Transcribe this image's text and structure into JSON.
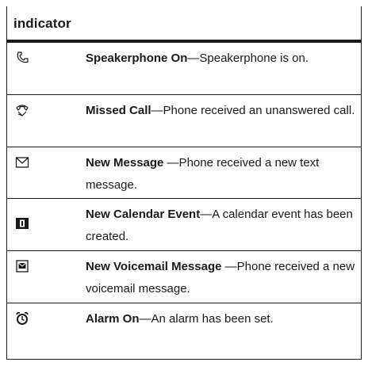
{
  "table": {
    "header": "indicator",
    "rows": [
      {
        "icon": "speakerphone-icon",
        "label": "Speakerphone On",
        "text": "—Speakerphone is on."
      },
      {
        "icon": "missed-call-icon",
        "label": "Missed Call",
        "text": "—Phone received an unanswered call."
      },
      {
        "icon": "envelope-icon",
        "label": "New Message",
        "text": " —Phone received a new text message."
      },
      {
        "icon": "calendar-icon",
        "label": "New Calendar Event",
        "text": "—A calendar event has been created."
      },
      {
        "icon": "voicemail-icon",
        "label": "New Voicemail Message",
        "text": " —Phone received a new voicemail message."
      },
      {
        "icon": "alarm-clock-icon",
        "label": "Alarm On",
        "text": "—An alarm has been set."
      }
    ]
  }
}
